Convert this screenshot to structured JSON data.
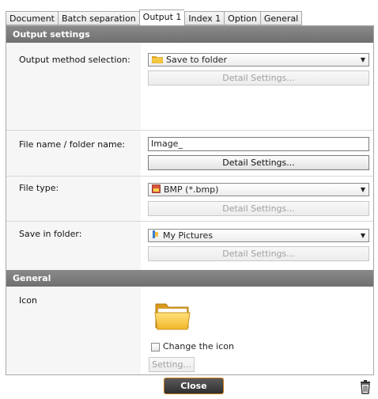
{
  "tabs": [
    {
      "label": "Document"
    },
    {
      "label": "Batch separation"
    },
    {
      "label": "Output 1",
      "active": true
    },
    {
      "label": "Index 1"
    },
    {
      "label": "Option"
    },
    {
      "label": "General"
    }
  ],
  "output_settings": {
    "header": "Output settings",
    "method_label": "Output method selection:",
    "method_value": "Save to folder",
    "method_detail": "Detail Settings...",
    "filename_label": "File name / folder name:",
    "filename_value": "Image_",
    "filename_detail": "Detail Settings...",
    "filetype_label": "File type:",
    "filetype_value": "BMP (*.bmp)",
    "filetype_detail": "Detail Settings...",
    "savein_label": "Save in folder:",
    "savein_value": "My Pictures",
    "savein_detail": "Detail Settings..."
  },
  "general": {
    "header": "General",
    "icon_label": "Icon",
    "change_icon_label": "Change the icon",
    "change_icon_checked": false,
    "setting_button": "Setting..."
  },
  "footer": {
    "close_label": "Close"
  },
  "icons": {
    "folder": "folder-icon",
    "bmp": "bmp-file-icon",
    "pictures": "my-pictures-icon",
    "trash": "trash-icon",
    "dropdown": "chevron-down-icon"
  },
  "colors": {
    "header_bg": "#7a7a7a",
    "close_border": "#c47a18",
    "folder_yellow": "#f5c842"
  }
}
